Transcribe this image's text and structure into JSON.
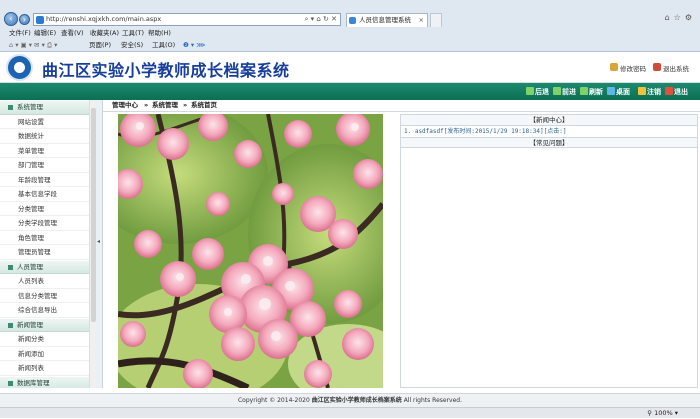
{
  "browser": {
    "address": "http://renshi.xqjxkh.com/main.aspx",
    "tab_title": "人员信息管理系统",
    "menu": [
      "文件(F)",
      "编辑(E)",
      "查看(V)",
      "收藏夹(A)",
      "工具(T)",
      "帮助(H)"
    ],
    "commands": [
      "页面(P)",
      "安全(S)",
      "工具(O)"
    ],
    "zoom": "100%"
  },
  "header": {
    "title": "曲江区实验小学教师成长档案系统",
    "change_password": "修改密码",
    "logout": "退出系统"
  },
  "toolbar": {
    "back": "后退",
    "forward": "前进",
    "refresh": "刷新",
    "desktop": "桌面",
    "cancel": "注销",
    "exit": "退出"
  },
  "sidebar": {
    "group1": "系统管理",
    "group1_items": [
      "网站设置",
      "数据统计",
      "菜单管理",
      "部门管理",
      "年龄段管理",
      "基本信息学段",
      "分类管理",
      "分类学段管理",
      "角色管理",
      "管理员管理"
    ],
    "group2": "人员管理",
    "group2_items": [
      "人员列表",
      "信息分类管理",
      "综合信息导出"
    ],
    "group3": "新闻管理",
    "group3_items": [
      "新闻分类",
      "新闻添加",
      "新闻列表"
    ],
    "group4": "数据库管理"
  },
  "breadcrumb": {
    "home": "管理中心",
    "sep": "»",
    "section": "系统管理",
    "page": "系统首页"
  },
  "news": {
    "title": "【新闻中心】",
    "items": [
      "1. asdfasdf[发布时间:2015/1/29 19:18:34][点击:]"
    ],
    "faq_title": "【常见问题】"
  },
  "footer": {
    "copyright": "Copyright © 2014-2020",
    "org": "曲江区实验小学教师成长档案系统",
    "rights": "All rights Reserved."
  },
  "colors": {
    "brand_blue": "#163e9a",
    "green_bar": "#0d6e53"
  }
}
